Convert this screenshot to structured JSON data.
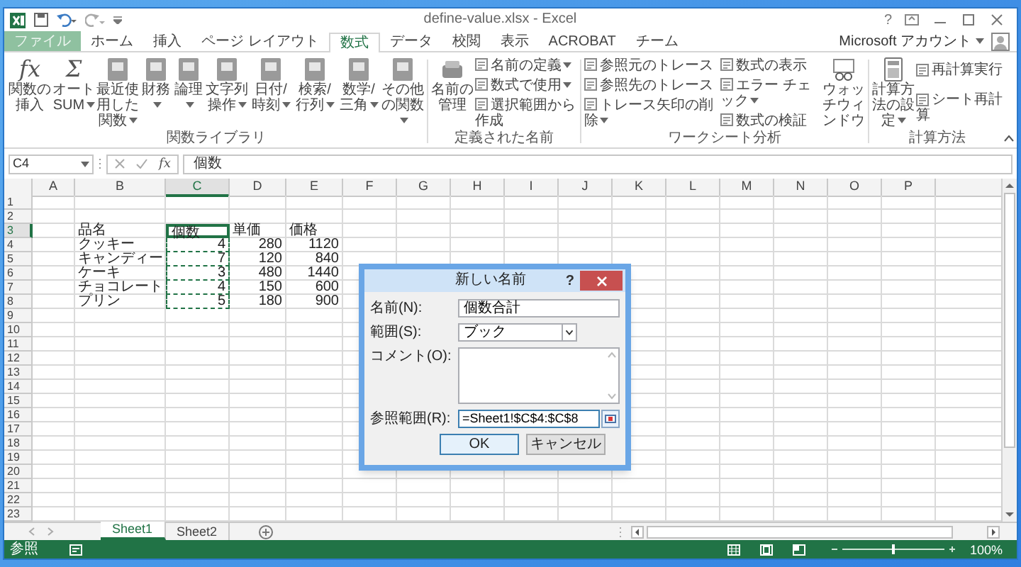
{
  "window": {
    "title": "define-value.xlsx - Excel",
    "help": "?"
  },
  "account": {
    "label": "Microsoft アカウント"
  },
  "tabs": [
    {
      "label": "ファイル",
      "kind": "file",
      "selected": false
    },
    {
      "label": "ホーム",
      "kind": "tab",
      "selected": false
    },
    {
      "label": "挿入",
      "kind": "tab",
      "selected": false
    },
    {
      "label": "ページ レイアウト",
      "kind": "tab",
      "selected": false
    },
    {
      "label": "数式",
      "kind": "tab",
      "selected": true
    },
    {
      "label": "データ",
      "kind": "tab",
      "selected": false
    },
    {
      "label": "校閲",
      "kind": "tab",
      "selected": false
    },
    {
      "label": "表示",
      "kind": "tab",
      "selected": false
    },
    {
      "label": "ACROBAT",
      "kind": "tab",
      "selected": false
    },
    {
      "label": "チーム",
      "kind": "tab",
      "selected": false
    }
  ],
  "ribbon": {
    "groups": [
      {
        "label": "関数ライブラリ",
        "columns": [
          {
            "kind": "large",
            "glyph": "fx",
            "label": "関数の挿入",
            "dropdown": false
          },
          {
            "kind": "large",
            "glyph": "Σ",
            "label": "オートSUM",
            "dropdown": true
          },
          {
            "kind": "large",
            "label": "最近使用した関数",
            "dropdown": true
          },
          {
            "kind": "large",
            "label": "財務",
            "dropdown": true
          },
          {
            "kind": "large",
            "label": "論理",
            "dropdown": true
          },
          {
            "kind": "large",
            "label": "文字列操作",
            "dropdown": true
          },
          {
            "kind": "large",
            "label": "日付/時刻",
            "dropdown": true
          },
          {
            "kind": "large",
            "label": "検索/行列",
            "dropdown": true
          },
          {
            "kind": "large",
            "label": "数学/三角",
            "dropdown": true
          },
          {
            "kind": "large",
            "label": "その他の関数",
            "dropdown": true
          }
        ]
      },
      {
        "label": "定義された名前",
        "columns": [
          {
            "kind": "large",
            "label": "名前の管理",
            "dropdown": false
          },
          {
            "kind": "stack",
            "items": [
              {
                "label": "名前の定義",
                "dropdown": true
              },
              {
                "label": "数式で使用",
                "dropdown": true
              },
              {
                "label": "選択範囲から作成",
                "dropdown": false
              }
            ]
          }
        ]
      },
      {
        "label": "ワークシート分析",
        "columns": [
          {
            "kind": "stack",
            "items": [
              {
                "label": "参照元のトレース",
                "dropdown": false
              },
              {
                "label": "参照先のトレース",
                "dropdown": false
              },
              {
                "label": "トレース矢印の削除",
                "dropdown": true
              }
            ]
          },
          {
            "kind": "stack",
            "items": [
              {
                "label": "数式の表示",
                "dropdown": false
              },
              {
                "label": "エラー チェック",
                "dropdown": true
              },
              {
                "label": "数式の検証",
                "dropdown": false
              }
            ]
          },
          {
            "kind": "large",
            "label": "ウォッチウィンドウ",
            "dropdown": false
          }
        ]
      },
      {
        "label": "計算方法",
        "columns": [
          {
            "kind": "large",
            "label": "計算方法の設定",
            "dropdown": true
          },
          {
            "kind": "stack",
            "items": [
              {
                "label": "再計算実行",
                "dropdown": false
              },
              {
                "label": "シート再計算",
                "dropdown": false
              }
            ]
          }
        ]
      }
    ]
  },
  "formula_bar": {
    "name_box": "C4",
    "fx": "fx",
    "value": "個数"
  },
  "sheet": {
    "columns": [
      {
        "label": "A",
        "selected": false
      },
      {
        "label": "B",
        "selected": false
      },
      {
        "label": "C",
        "selected": true
      },
      {
        "label": "D",
        "selected": false
      },
      {
        "label": "E",
        "selected": false
      },
      {
        "label": "F",
        "selected": false
      },
      {
        "label": "G",
        "selected": false
      },
      {
        "label": "H",
        "selected": false
      },
      {
        "label": "I",
        "selected": false
      },
      {
        "label": "J",
        "selected": false
      },
      {
        "label": "K",
        "selected": false
      },
      {
        "label": "L",
        "selected": false
      },
      {
        "label": "M",
        "selected": false
      },
      {
        "label": "N",
        "selected": false
      },
      {
        "label": "O",
        "selected": false
      },
      {
        "label": "P",
        "selected": false
      }
    ],
    "rows": [
      {
        "label": "1",
        "selected": false
      },
      {
        "label": "2",
        "selected": false
      },
      {
        "label": "3",
        "selected": true,
        "cells": [
          null,
          {
            "text": "品名",
            "kind": "text",
            "active": false,
            "marquee": false
          },
          {
            "text": "個数",
            "kind": "text",
            "active": true,
            "marquee": false
          },
          {
            "text": "単価",
            "kind": "text",
            "active": false,
            "marquee": false
          },
          {
            "text": "価格",
            "kind": "text",
            "active": false,
            "marquee": false
          }
        ]
      },
      {
        "label": "4",
        "selected": false,
        "cells": [
          null,
          {
            "text": "クッキー",
            "kind": "text",
            "active": false,
            "marquee": false
          },
          {
            "text": "4",
            "kind": "number",
            "active": false,
            "marquee": true
          },
          {
            "text": "280",
            "kind": "number",
            "active": false,
            "marquee": false
          },
          {
            "text": "1120",
            "kind": "number",
            "active": false,
            "marquee": false
          }
        ]
      },
      {
        "label": "5",
        "selected": false,
        "cells": [
          null,
          {
            "text": "キャンディー",
            "kind": "text",
            "active": false,
            "marquee": false
          },
          {
            "text": "7",
            "kind": "number",
            "active": false,
            "marquee": true
          },
          {
            "text": "120",
            "kind": "number",
            "active": false,
            "marquee": false
          },
          {
            "text": "840",
            "kind": "number",
            "active": false,
            "marquee": false
          }
        ]
      },
      {
        "label": "6",
        "selected": false,
        "cells": [
          null,
          {
            "text": "ケーキ",
            "kind": "text",
            "active": false,
            "marquee": false
          },
          {
            "text": "3",
            "kind": "number",
            "active": false,
            "marquee": true
          },
          {
            "text": "480",
            "kind": "number",
            "active": false,
            "marquee": false
          },
          {
            "text": "1440",
            "kind": "number",
            "active": false,
            "marquee": false
          }
        ]
      },
      {
        "label": "7",
        "selected": false,
        "cells": [
          null,
          {
            "text": "チョコレート",
            "kind": "text",
            "active": false,
            "marquee": false
          },
          {
            "text": "4",
            "kind": "number",
            "active": false,
            "marquee": true
          },
          {
            "text": "150",
            "kind": "number",
            "active": false,
            "marquee": false
          },
          {
            "text": "600",
            "kind": "number",
            "active": false,
            "marquee": false
          }
        ]
      },
      {
        "label": "8",
        "selected": false,
        "cells": [
          null,
          {
            "text": "プリン",
            "kind": "text",
            "active": false,
            "marquee": false
          },
          {
            "text": "5",
            "kind": "number",
            "active": false,
            "marquee": true
          },
          {
            "text": "180",
            "kind": "number",
            "active": false,
            "marquee": false
          },
          {
            "text": "900",
            "kind": "number",
            "active": false,
            "marquee": false
          }
        ]
      },
      {
        "label": "9",
        "selected": false
      },
      {
        "label": "10",
        "selected": false
      },
      {
        "label": "11",
        "selected": false
      },
      {
        "label": "12",
        "selected": false
      },
      {
        "label": "13",
        "selected": false
      },
      {
        "label": "14",
        "selected": false
      },
      {
        "label": "15",
        "selected": false
      },
      {
        "label": "16",
        "selected": false
      },
      {
        "label": "17",
        "selected": false
      },
      {
        "label": "18",
        "selected": false
      },
      {
        "label": "19",
        "selected": false
      },
      {
        "label": "20",
        "selected": false
      },
      {
        "label": "21",
        "selected": false
      },
      {
        "label": "22",
        "selected": false
      },
      {
        "label": "23",
        "selected": false
      }
    ]
  },
  "sheet_tabs": [
    {
      "label": "Sheet1",
      "selected": true
    },
    {
      "label": "Sheet2",
      "selected": false
    }
  ],
  "status_bar": {
    "mode": "参照",
    "zoom": {
      "level": 0.5,
      "reading": "100%"
    }
  },
  "dialog": {
    "title": "新しい名前",
    "help": "?",
    "fields": [
      {
        "kind": "text",
        "label": "名前(N):",
        "value": "個数合計"
      },
      {
        "kind": "select",
        "label": "範囲(S):",
        "value": "ブック"
      },
      {
        "kind": "textarea",
        "label": "コメント(O):"
      },
      {
        "kind": "reference",
        "label": "参照範囲(R):",
        "value": "=Sheet1!$C$4:$C$8"
      }
    ],
    "buttons": [
      {
        "label": "OK",
        "default": true
      },
      {
        "label": "キャンセル",
        "default": false
      }
    ]
  }
}
